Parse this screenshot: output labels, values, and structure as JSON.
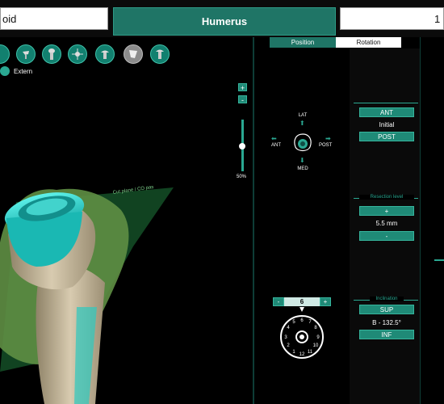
{
  "header": {
    "left_tab": "oid",
    "center_tab": "Humerus",
    "right_tab": "1"
  },
  "toolbar": {
    "tools": [
      "tool-1",
      "tool-2",
      "tool-3",
      "tool-4",
      "tool-5",
      "tool-6",
      "tool-7"
    ],
    "extern_label": "Extern"
  },
  "viewer": {
    "plane_label": "Cut plane / CO pas",
    "zoom_in": "+",
    "zoom_out": "-",
    "zoom_value": "50%"
  },
  "panel_tabs": {
    "position": "Position",
    "rotation": "Rotation"
  },
  "orientation": {
    "lat": "LAT",
    "med": "MED",
    "ant": "ANT",
    "post": "POST"
  },
  "ant_post": {
    "ant_label": "ANT",
    "value": "Initial",
    "post_label": "POST"
  },
  "resection": {
    "title": "Resection level",
    "plus": "+",
    "value": "5.5 mm",
    "minus": "-"
  },
  "dial": {
    "minus": "-",
    "value": "6",
    "plus": "+"
  },
  "inclination": {
    "title": "Inclination",
    "sup_label": "SUP",
    "value": "B - 132.5°",
    "inf_label": "INF"
  },
  "colors": {
    "accent": "#1f8a77",
    "active_tab": "#1f7566",
    "bone": "#c9bca1",
    "soft_tissue": "#6a9a49",
    "implant": "#2cd8d0"
  }
}
